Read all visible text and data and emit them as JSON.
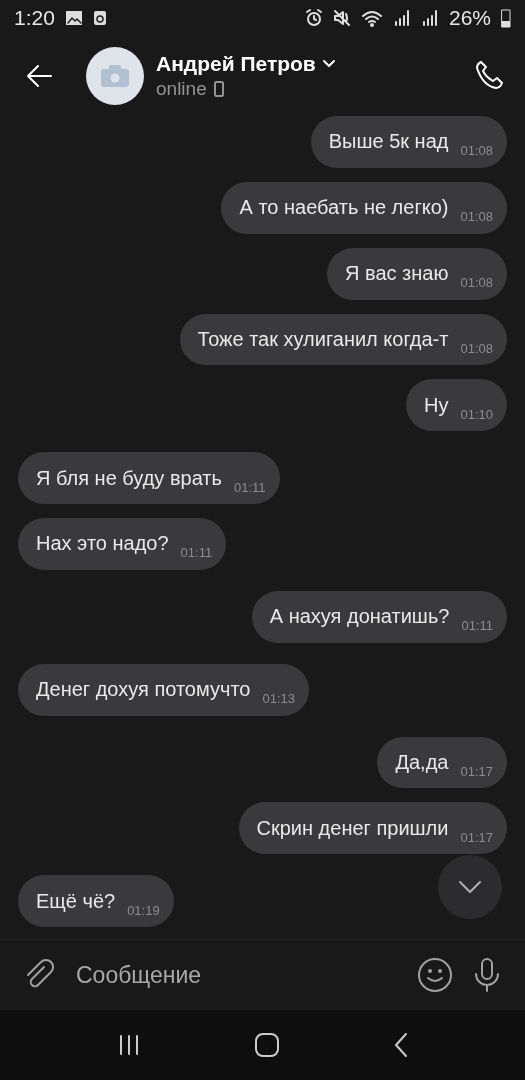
{
  "status_bar": {
    "time": "1:20",
    "battery": "26%"
  },
  "header": {
    "name": "Андрей Петров",
    "status": "online"
  },
  "messages": [
    {
      "text": "Выше 5к над",
      "time": "01:08",
      "kind": "outgoing"
    },
    {
      "text": "А то наебать не легко)",
      "time": "01:08",
      "kind": "outgoing"
    },
    {
      "text": "Я вас знаю",
      "time": "01:08",
      "kind": "outgoing"
    },
    {
      "text": "Тоже так хулиганил когда-т",
      "time": "01:08",
      "kind": "outgoing"
    },
    {
      "text": "Ну",
      "time": "01:10",
      "kind": "outgoing"
    },
    {
      "text": "Я бля не буду врать",
      "time": "01:11",
      "kind": "incoming"
    },
    {
      "text": "Нах это надо?",
      "time": "01:11",
      "kind": "incoming"
    },
    {
      "text": "А нахуя донатишь?",
      "time": "01:11",
      "kind": "outgoing"
    },
    {
      "text": "Денег дохуя потомучто",
      "time": "01:13",
      "kind": "incoming"
    },
    {
      "text": "Да,да",
      "time": "01:17",
      "kind": "outgoing"
    },
    {
      "text": "Скрин денег пришли",
      "time": "01:17",
      "kind": "outgoing"
    },
    {
      "text": "Ещё чё?",
      "time": "01:19",
      "kind": "incoming"
    }
  ],
  "composer": {
    "placeholder": "Сообщение"
  }
}
